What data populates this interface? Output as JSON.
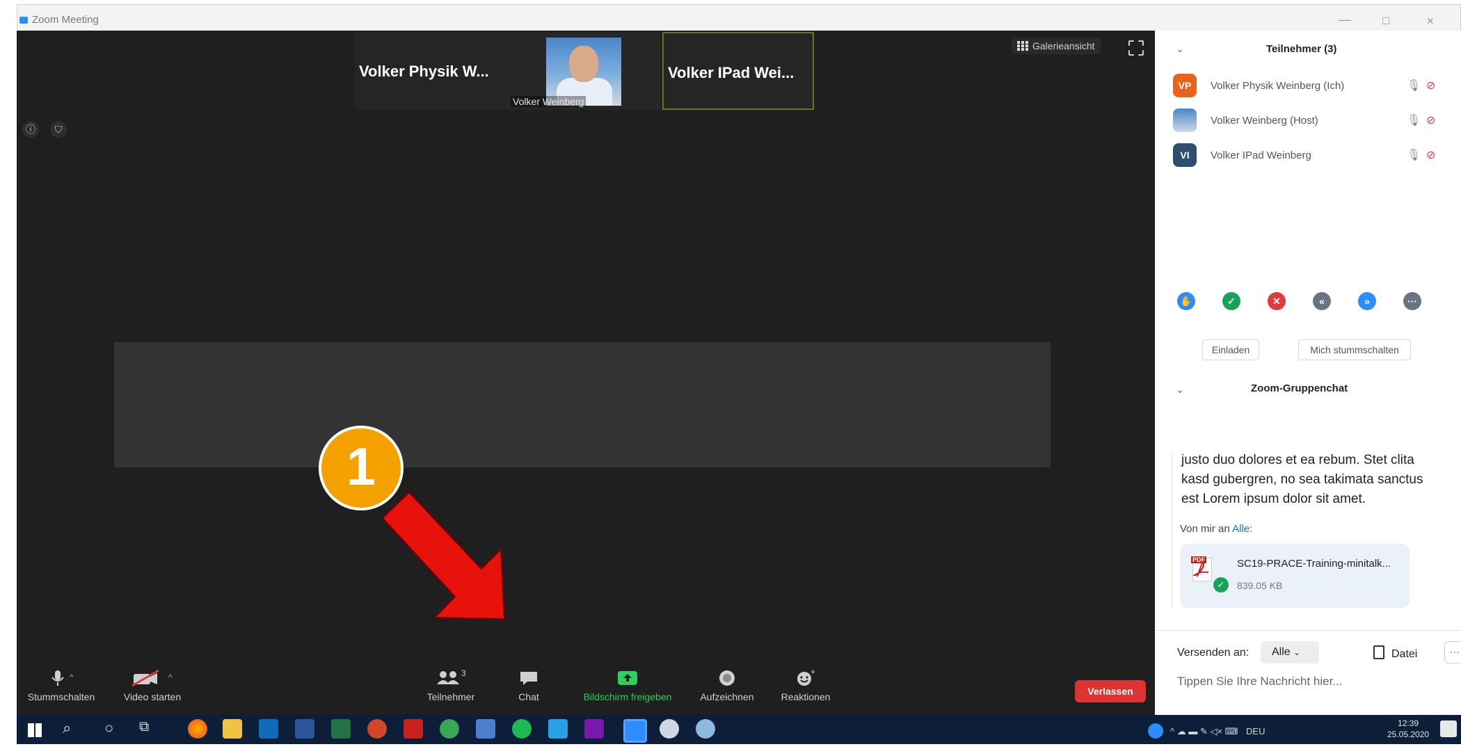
{
  "window": {
    "title": "Zoom Meeting",
    "controls": [
      "—",
      "☐",
      "✕"
    ]
  },
  "stage": {
    "thumbnails": [
      {
        "name": "Volker Physik W..."
      },
      {
        "name": "Volker Weinberg"
      },
      {
        "name": "Volker IPad Wei..."
      }
    ],
    "gallery_label": "Galerieansicht",
    "badge_number": "1"
  },
  "toolbar": {
    "mute": "Stummschalten",
    "video": "Video starten",
    "participants": "Teilnehmer",
    "participant_count": "3",
    "chat": "Chat",
    "share": "Bildschirm freigeben",
    "record": "Aufzeichnen",
    "reactions": "Reaktionen",
    "leave": "Verlassen"
  },
  "participants_panel": {
    "title": "Teilnehmer (3)",
    "participants": [
      {
        "initials": "VP",
        "name": "Volker Physik Weinberg (Ich)",
        "color": "#e8631c"
      },
      {
        "initials": "",
        "name": "Volker Weinberg (Host)",
        "color": "#5b86c0"
      },
      {
        "initials": "VI",
        "name": "Volker IPad Weinberg",
        "color": "#2f4d6e"
      }
    ],
    "reactions": [
      {
        "icon": "raise-hand-icon",
        "color": "#2d8cff",
        "glyph": "✋"
      },
      {
        "icon": "yes-icon",
        "color": "#19a35a",
        "glyph": "✓"
      },
      {
        "icon": "no-icon",
        "color": "#e23b3b",
        "glyph": "✕"
      },
      {
        "icon": "slower-icon",
        "color": "#6b7280",
        "glyph": "«"
      },
      {
        "icon": "faster-icon",
        "color": "#2d8cff",
        "glyph": "»"
      },
      {
        "icon": "more-icon",
        "color": "#6b7280",
        "glyph": "···"
      }
    ],
    "invite": "Einladen",
    "mute_me": "Mich stummschalten"
  },
  "chat": {
    "title": "Zoom-Gruppenchat",
    "message_lines": [
      "justo duo dolores et ea rebum. Stet clita",
      "kasd gubergren, no sea takimata sanctus",
      "est Lorem ipsum dolor sit amet."
    ],
    "from_prefix": "Von mir an",
    "from_target": "Alle:",
    "file": {
      "tag": "PDF",
      "name": "SC19-PRACE-Training-minitalk...",
      "size": "839.05 KB"
    },
    "send_to_label": "Versenden an:",
    "send_to_value": "Alle",
    "file_button": "Datei",
    "more": "···",
    "placeholder": "Tippen Sie Ihre Nachricht hier..."
  },
  "taskbar": {
    "language": "DEU",
    "time": "12:39",
    "date": "25.05.2020"
  }
}
